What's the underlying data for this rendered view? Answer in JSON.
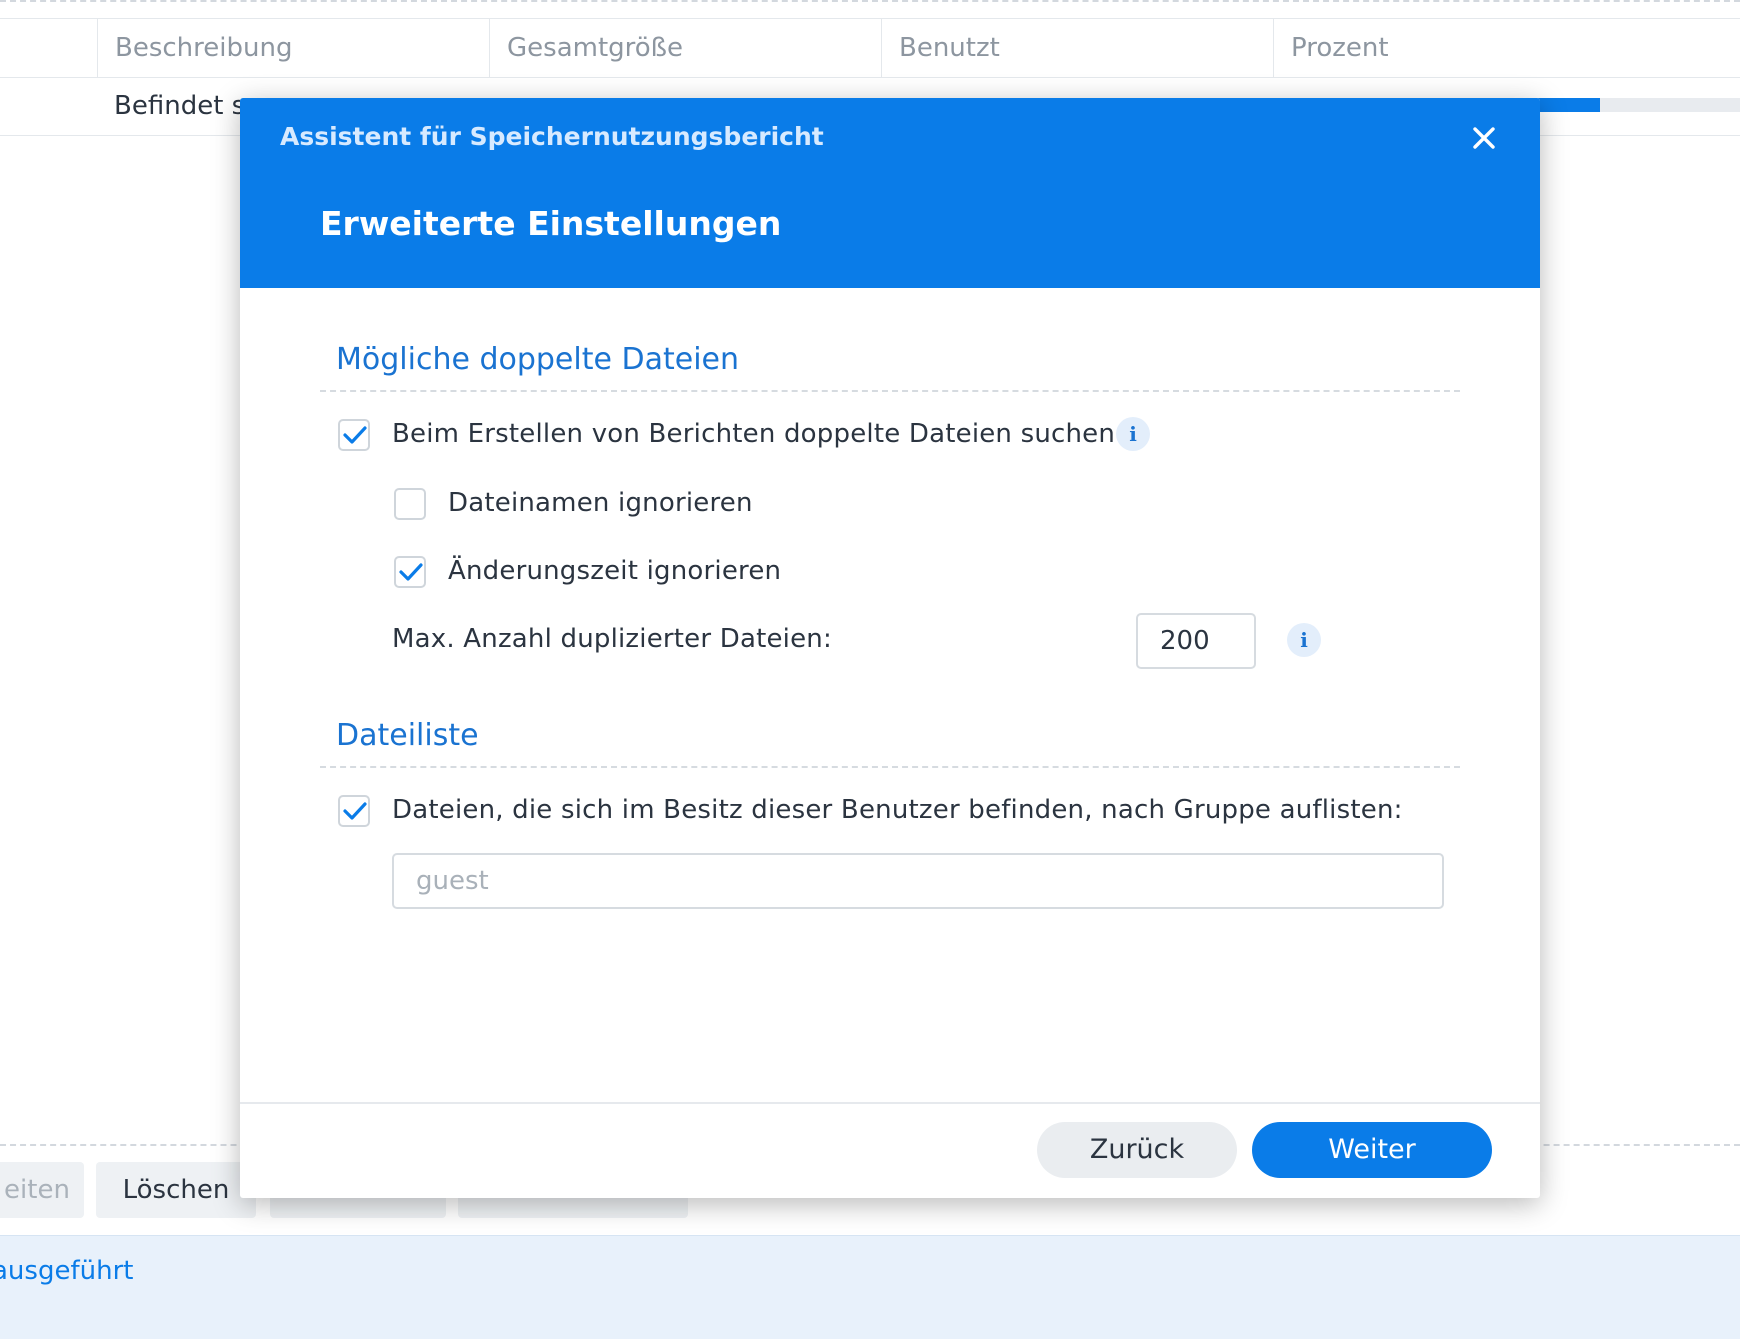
{
  "table": {
    "columns": [
      "",
      "Beschreibung",
      "Gesamtgröße",
      "Benutzt",
      "Prozent"
    ],
    "row": {
      "description": "Befindet s",
      "usage_percent": 72
    }
  },
  "toolbar": {
    "buttons": [
      {
        "label": "eiten",
        "enabled": false
      },
      {
        "label": "Löschen",
        "enabled": true
      }
    ]
  },
  "status": {
    "text": "ausgeführt"
  },
  "dialog": {
    "title": "Assistent für Speichernutzungsbericht",
    "subtitle": "Erweiterte Einstellungen",
    "section_duplicates": {
      "title": "Mögliche doppelte Dateien",
      "search_duplicates": {
        "label": "Beim Erstellen von Berichten doppelte Dateien suchen",
        "checked": true
      },
      "ignore_filenames": {
        "label": "Dateinamen ignorieren",
        "checked": false
      },
      "ignore_mtime": {
        "label": "Änderungszeit ignorieren",
        "checked": true
      },
      "max_duplicates": {
        "label": "Max. Anzahl duplizierter Dateien:",
        "value": "200"
      }
    },
    "section_filelist": {
      "title": "Dateiliste",
      "list_by_group": {
        "label": "Dateien, die sich im Besitz dieser Benutzer befinden, nach Gruppe auflisten:",
        "checked": true
      },
      "users_input": {
        "value": "",
        "placeholder": "guest"
      }
    },
    "buttons": {
      "back": "Zurück",
      "next": "Weiter"
    },
    "icons": {
      "close": "close-icon",
      "info": "info-icon",
      "check": "check-icon"
    },
    "colors": {
      "accent": "#0a7ce8",
      "header_bg": "#0a7ce8"
    }
  }
}
